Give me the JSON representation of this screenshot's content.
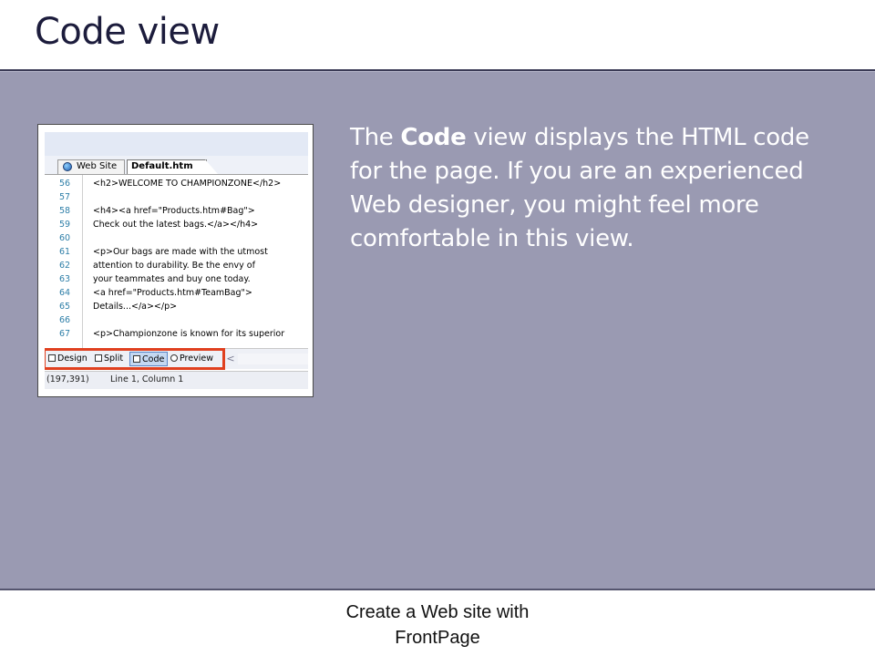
{
  "slide": {
    "title": "Code view",
    "body_prefix": "The ",
    "body_bold": "Code",
    "body_suffix": " view displays the HTML code for the page. If you are an experienced Web designer, you might feel more comfortable in this view.",
    "footer_line1": "Create a Web site with",
    "footer_line2": "FrontPage"
  },
  "screenshot": {
    "tabs": [
      "Web Site",
      "Default.htm"
    ],
    "code_lines": [
      {
        "num": "56",
        "text": "<h2>WELCOME TO CHAMPIONZONE</h2>"
      },
      {
        "num": "57",
        "text": ""
      },
      {
        "num": "58",
        "text": "<h4><a href=\"Products.htm#Bag\">"
      },
      {
        "num": "59",
        "text": "Check out the latest bags.</a></h4>"
      },
      {
        "num": "60",
        "text": ""
      },
      {
        "num": "61",
        "text": "<p>Our bags are made with the utmost"
      },
      {
        "num": "62",
        "text": "attention to durability. Be the envy of"
      },
      {
        "num": "63",
        "text": "your teammates and buy one today."
      },
      {
        "num": "64",
        "text": "<a href=\"Products.htm#TeamBag\">"
      },
      {
        "num": "65",
        "text": "Details...</a></p>"
      },
      {
        "num": "66",
        "text": ""
      },
      {
        "num": "67",
        "text": "<p>Championzone is known for its superior"
      }
    ],
    "view_buttons": [
      "Design",
      "Split",
      "Code",
      "Preview"
    ],
    "scroll_arrow": "<",
    "status_coords": "(197,391)",
    "status_position": "Line 1, Column 1"
  },
  "colors": {
    "panel": "#9a9ab2",
    "title": "#1c1c3c",
    "highlight": "#e0401f",
    "line_numbers": "#2f7fa8"
  }
}
